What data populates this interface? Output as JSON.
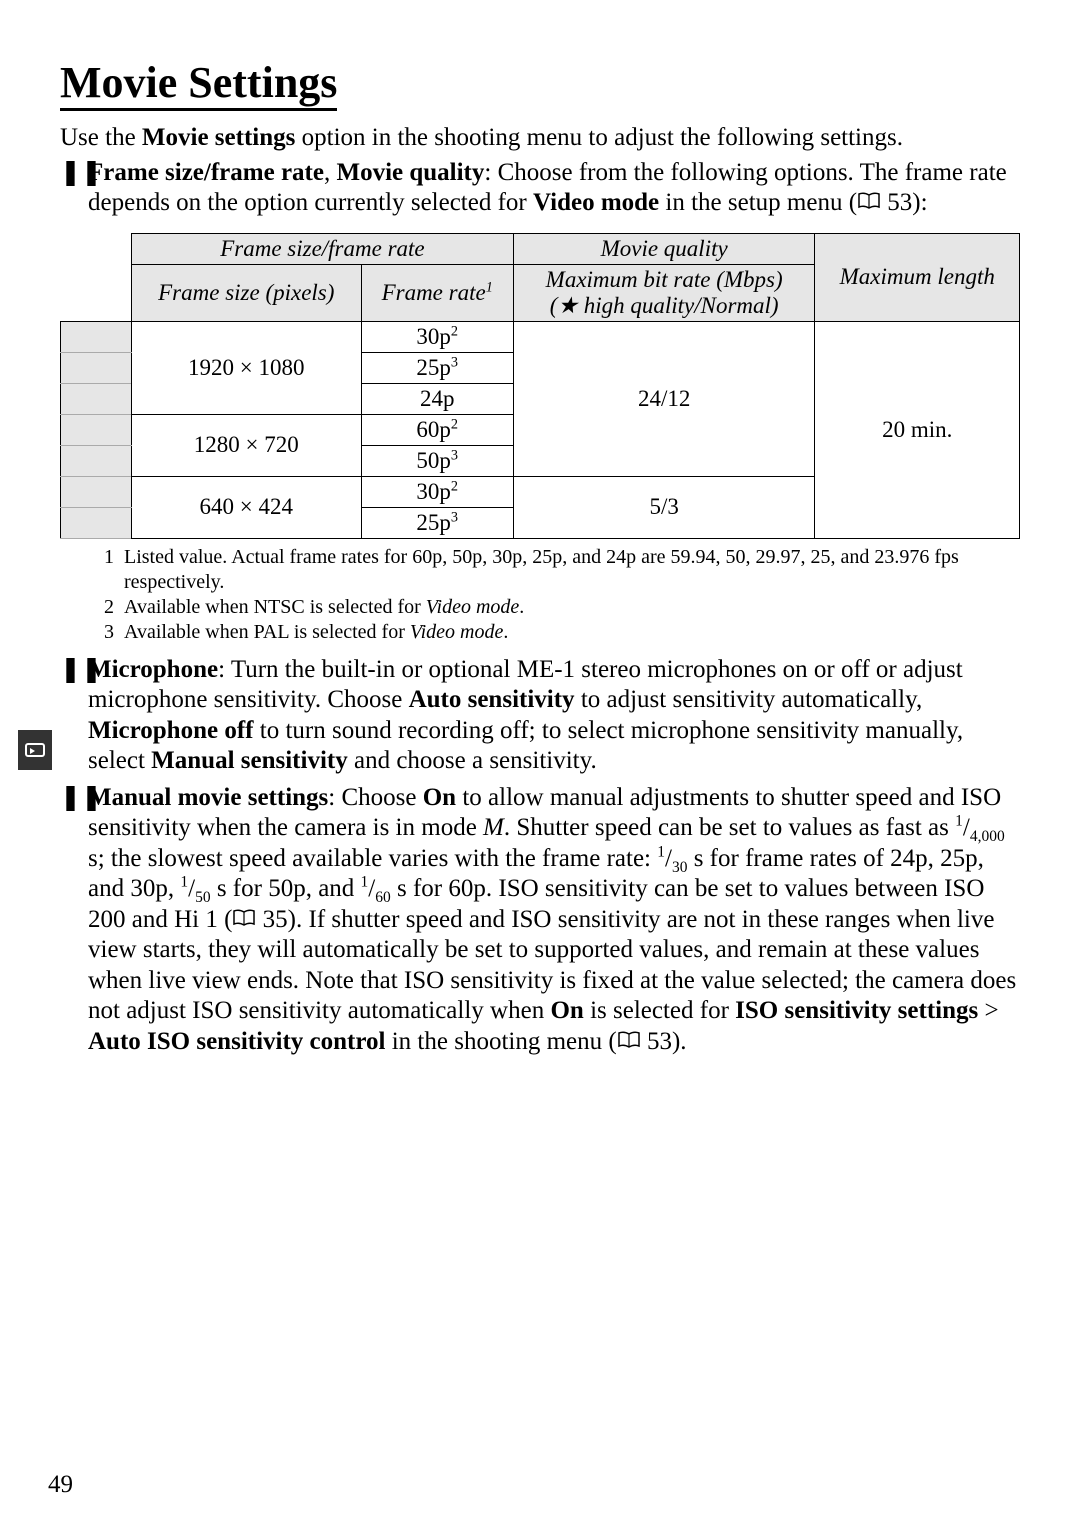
{
  "page_number": "49",
  "title": "Movie Settings",
  "intro": {
    "pre": "Use the ",
    "bold1": "Movie settings",
    "post": " option in the shooting menu to adjust the following settings."
  },
  "bullets": {
    "b1": {
      "bold1": "Frame size/frame rate",
      "sep": ", ",
      "bold2": "Movie quality",
      "text1": ": Choose from the following options.  The frame rate depends on the option currently selected for ",
      "bold3": "Video mode",
      "text2": " in the setup menu (",
      "ref": "53",
      "text3": "):"
    },
    "b2": {
      "bold1": "Microphone",
      "text1": ": Turn the built-in or optional ME-1 stereo microphones on or off or adjust microphone sensitivity.  Choose ",
      "bold2": "Auto sensitivity",
      "text2": " to adjust sensitivity automatically, ",
      "bold3": "Microphone off",
      "text3": " to turn sound recording off; to select microphone sensitivity manually, select ",
      "bold4": "Manual sensitivity",
      "text4": " and choose a sensitivity."
    },
    "b3": {
      "bold1": "Manual movie settings",
      "text1": ": Choose ",
      "bold2": "On",
      "text2": " to allow manual adjustments to shutter speed and ISO sensitivity when the camera is in mode ",
      "modeM": "M",
      "text3": ".  Shutter speed can be set to values as fast as ",
      "frac1n": "1",
      "frac1d": "4,000",
      "text4": " s; the slowest speed available varies with the frame rate: ",
      "frac2n": "1",
      "frac2d": "30",
      "text5": " s for frame rates of 24p, 25p, and 30p, ",
      "frac3n": "1",
      "frac3d": "50",
      "text6": " s for 50p, and ",
      "frac4n": "1",
      "frac4d": "60",
      "text7": " s for 60p.  ISO sensitivity can be set to values between ISO 200 and Hi 1 (",
      "ref1": "35",
      "text8": ").  If shutter speed and ISO sensitivity are not in these ranges when live view starts, they will automatically be set to supported values, and remain at these values when live view ends.  Note that ISO sensitivity is fixed at the value selected; the camera does not adjust ISO sensitivity automatically when ",
      "bold3": "On",
      "text9": " is selected for ",
      "bold4": "ISO sensitivity settings",
      "gt": " > ",
      "bold5": "Auto ISO sensitivity control",
      "text10": " in the shooting menu (",
      "ref2": "53",
      "text11": ")."
    }
  },
  "table": {
    "head": {
      "c1": "Frame size/frame rate",
      "c2": "Movie quality",
      "c3": "Maximum length",
      "c1a": "Frame size (pixels)",
      "c1b": "Frame rate",
      "c2a_l1": "Maximum bit rate (Mbps)",
      "c2a_l2": "(★ high quality/Normal)",
      "fr_sup": "1"
    },
    "rows": [
      {
        "size": "1920 × 1080",
        "rate": "30p",
        "rsup": "2"
      },
      {
        "size": "",
        "rate": "25p",
        "rsup": "3"
      },
      {
        "size": "",
        "rate": "24p",
        "rsup": ""
      },
      {
        "size": "1280 ×   720",
        "rate": "60p",
        "rsup": "2"
      },
      {
        "size": "",
        "rate": "50p",
        "rsup": "3"
      },
      {
        "size": "640 ×   424",
        "rate": "30p",
        "rsup": "2"
      },
      {
        "size": "",
        "rate": "25p",
        "rsup": "3"
      }
    ],
    "quality1": "24/12",
    "quality2": "5/3",
    "maxlen": "20 min."
  },
  "footnotes": {
    "f1n": "1",
    "f1": "Listed value.  Actual frame rates for 60p, 50p, 30p, 25p, and 24p are 59.94, 50, 29.97, 25, and 23.976 fps respectively.",
    "f2n": "2",
    "f2a": "Available when ",
    "f2b": "NTSC",
    "f2c": " is selected for ",
    "f2d": "Video mode",
    "f2e": ".",
    "f3n": "3",
    "f3a": "Available when ",
    "f3b": "PAL",
    "f3c": " is selected for ",
    "f3d": "Video mode",
    "f3e": "."
  }
}
